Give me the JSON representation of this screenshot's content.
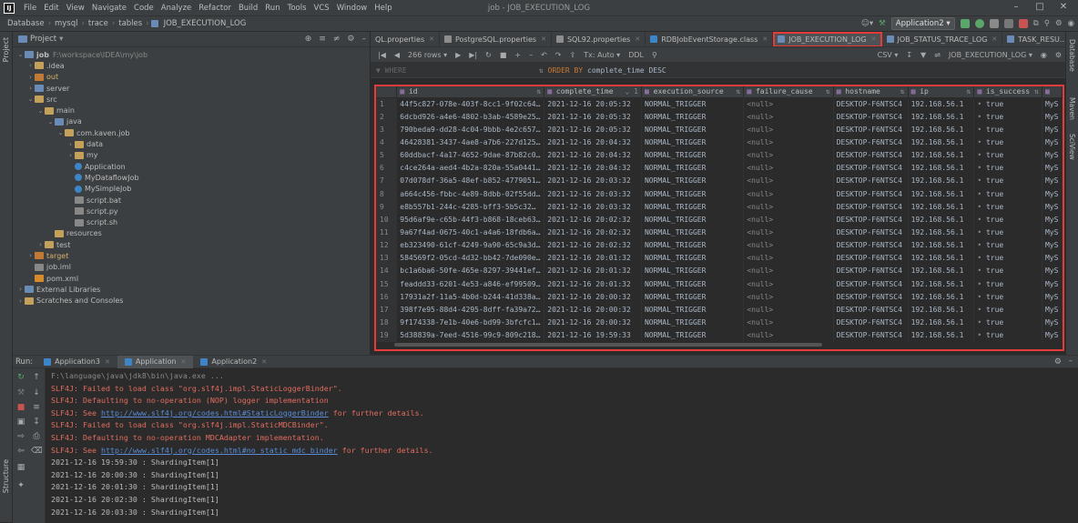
{
  "titlebar": {
    "menu": [
      "File",
      "Edit",
      "View",
      "Navigate",
      "Code",
      "Analyze",
      "Refactor",
      "Build",
      "Run",
      "Tools",
      "VCS",
      "Window",
      "Help"
    ],
    "title": "job - JOB_EXECUTION_LOG"
  },
  "breadcrumb": [
    "Database",
    "mysql",
    "trace",
    "tables",
    "JOB_EXECUTION_LOG"
  ],
  "toolbar": {
    "run_config": "Application2"
  },
  "project": {
    "header": "Project",
    "tree": [
      {
        "label": "job",
        "note": "F:\\workspace\\IDEA\\my\\job",
        "depth": 0,
        "open": true,
        "kind": "folder-blue"
      },
      {
        "label": ".idea",
        "depth": 1,
        "open": false,
        "kind": "folder"
      },
      {
        "label": "out",
        "depth": 1,
        "open": false,
        "kind": "folder-orange",
        "highlight": true
      },
      {
        "label": "server",
        "depth": 1,
        "open": false,
        "kind": "folder-blue"
      },
      {
        "label": "src",
        "depth": 1,
        "open": true,
        "kind": "folder"
      },
      {
        "label": "main",
        "depth": 2,
        "open": true,
        "kind": "folder"
      },
      {
        "label": "java",
        "depth": 3,
        "open": true,
        "kind": "folder-blue"
      },
      {
        "label": "com.kaven.job",
        "depth": 4,
        "open": true,
        "kind": "folder"
      },
      {
        "label": "data",
        "depth": 5,
        "open": false,
        "kind": "folder"
      },
      {
        "label": "my",
        "depth": 5,
        "open": false,
        "kind": "folder"
      },
      {
        "label": "Application",
        "depth": 5,
        "kind": "jcls"
      },
      {
        "label": "MyDataflowJob",
        "depth": 5,
        "kind": "jcls"
      },
      {
        "label": "MySimpleJob",
        "depth": 5,
        "kind": "jcls"
      },
      {
        "label": "script.bat",
        "depth": 5,
        "kind": "sfile"
      },
      {
        "label": "script.py",
        "depth": 5,
        "kind": "sfile"
      },
      {
        "label": "script.sh",
        "depth": 5,
        "kind": "sfile"
      },
      {
        "label": "resources",
        "depth": 3,
        "kind": "folder"
      },
      {
        "label": "test",
        "depth": 2,
        "open": false,
        "kind": "folder"
      },
      {
        "label": "target",
        "depth": 1,
        "open": false,
        "kind": "folder-orange",
        "highlight": true
      },
      {
        "label": "job.iml",
        "depth": 1,
        "kind": "sfile"
      },
      {
        "label": "pom.xml",
        "depth": 1,
        "kind": "xmlfile"
      },
      {
        "label": "External Libraries",
        "depth": 0,
        "open": false,
        "kind": "folder-blue"
      },
      {
        "label": "Scratches and Consoles",
        "depth": 0,
        "open": false,
        "kind": "folder"
      }
    ]
  },
  "editor": {
    "tabs": [
      {
        "label": "QL.properties",
        "color": "#8e8e8e"
      },
      {
        "label": "PostgreSQL.properties",
        "color": "#8e8e8e"
      },
      {
        "label": "SQL92.properties",
        "color": "#8e8e8e"
      },
      {
        "label": "RDBJobEventStorage.class",
        "color": "#3d85c6"
      },
      {
        "label": "JOB_EXECUTION_LOG",
        "color": "#6a8bb5",
        "active": true
      },
      {
        "label": "JOB_STATUS_TRACE_LOG",
        "color": "#6a8bb5"
      },
      {
        "label": "TASK_RESU...STATISTICS",
        "color": "#6a8bb5"
      }
    ],
    "db_toolbar": {
      "rows": "266 rows",
      "tx": "Tx: Auto",
      "ddl": "DDL",
      "export": "CSV",
      "table_selector": "JOB_EXECUTION_LOG"
    },
    "filter": {
      "where": "WHERE",
      "order_by_kw": "ORDER BY",
      "order_by_val": "complete_time DESC"
    },
    "columns": [
      "id",
      "complete_time",
      "execution_source",
      "failure_cause",
      "hostname",
      "ip",
      "is_success",
      ""
    ],
    "rows": [
      [
        "1",
        "44f5c827-078e-403f-8cc1-9f02c64…",
        "2021-12-16 20:05:32",
        "NORMAL_TRIGGER",
        "<null>",
        "DESKTOP-F6NTSC4",
        "192.168.56.1",
        "true",
        "MyS"
      ],
      [
        "2",
        "6dcbd926-a4e6-4802-b3ab-4589e25…",
        "2021-12-16 20:05:32",
        "NORMAL_TRIGGER",
        "<null>",
        "DESKTOP-F6NTSC4",
        "192.168.56.1",
        "true",
        "MyS"
      ],
      [
        "3",
        "790beda9-dd28-4c04-9bbb-4e2c657…",
        "2021-12-16 20:05:32",
        "NORMAL_TRIGGER",
        "<null>",
        "DESKTOP-F6NTSC4",
        "192.168.56.1",
        "true",
        "MyS"
      ],
      [
        "4",
        "46428381-3437-4ae8-a7b6-227d125…",
        "2021-12-16 20:04:32",
        "NORMAL_TRIGGER",
        "<null>",
        "DESKTOP-F6NTSC4",
        "192.168.56.1",
        "true",
        "MyS"
      ],
      [
        "5",
        "60ddbacf-4a17-4652-9dae-87b82c0…",
        "2021-12-16 20:04:32",
        "NORMAL_TRIGGER",
        "<null>",
        "DESKTOP-F6NTSC4",
        "192.168.56.1",
        "true",
        "MyS"
      ],
      [
        "6",
        "c4ce264a-aed4-4b2a-820a-55a0441…",
        "2021-12-16 20:04:32",
        "NORMAL_TRIGGER",
        "<null>",
        "DESKTOP-F6NTSC4",
        "192.168.56.1",
        "true",
        "MyS"
      ],
      [
        "7",
        "07d078df-36a5-48ef-b852-4779051…",
        "2021-12-16 20:03:32",
        "NORMAL_TRIGGER",
        "<null>",
        "DESKTOP-F6NTSC4",
        "192.168.56.1",
        "true",
        "MyS"
      ],
      [
        "8",
        "a664c456-fbbc-4e89-8dbb-02f55dd…",
        "2021-12-16 20:03:32",
        "NORMAL_TRIGGER",
        "<null>",
        "DESKTOP-F6NTSC4",
        "192.168.56.1",
        "true",
        "MyS"
      ],
      [
        "9",
        "e8b557b1-244c-4285-bff3-5b5c32…",
        "2021-12-16 20:03:32",
        "NORMAL_TRIGGER",
        "<null>",
        "DESKTOP-F6NTSC4",
        "192.168.56.1",
        "true",
        "MyS"
      ],
      [
        "10",
        "95d6af9e-c65b-44f3-b868-18ceb63…",
        "2021-12-16 20:02:32",
        "NORMAL_TRIGGER",
        "<null>",
        "DESKTOP-F6NTSC4",
        "192.168.56.1",
        "true",
        "MyS"
      ],
      [
        "11",
        "9a67f4ad-0675-40c1-a4a6-18fdb6a…",
        "2021-12-16 20:02:32",
        "NORMAL_TRIGGER",
        "<null>",
        "DESKTOP-F6NTSC4",
        "192.168.56.1",
        "true",
        "MyS"
      ],
      [
        "12",
        "eb323490-61cf-4249-9a90-65c9a3d…",
        "2021-12-16 20:02:32",
        "NORMAL_TRIGGER",
        "<null>",
        "DESKTOP-F6NTSC4",
        "192.168.56.1",
        "true",
        "MyS"
      ],
      [
        "13",
        "584569f2-05cd-4d32-bb42-7de090e…",
        "2021-12-16 20:01:32",
        "NORMAL_TRIGGER",
        "<null>",
        "DESKTOP-F6NTSC4",
        "192.168.56.1",
        "true",
        "MyS"
      ],
      [
        "14",
        "bc1a6ba6-50fe-465e-8297-39441ef…",
        "2021-12-16 20:01:32",
        "NORMAL_TRIGGER",
        "<null>",
        "DESKTOP-F6NTSC4",
        "192.168.56.1",
        "true",
        "MyS"
      ],
      [
        "15",
        "feaddd33-6201-4e53-a846-ef99509…",
        "2021-12-16 20:01:32",
        "NORMAL_TRIGGER",
        "<null>",
        "DESKTOP-F6NTSC4",
        "192.168.56.1",
        "true",
        "MyS"
      ],
      [
        "16",
        "17931a2f-11a5-4b0d-b244-41d338a…",
        "2021-12-16 20:00:32",
        "NORMAL_TRIGGER",
        "<null>",
        "DESKTOP-F6NTSC4",
        "192.168.56.1",
        "true",
        "MyS"
      ],
      [
        "17",
        "398f7e95-88d4-4295-8dff-fa39a72…",
        "2021-12-16 20:00:32",
        "NORMAL_TRIGGER",
        "<null>",
        "DESKTOP-F6NTSC4",
        "192.168.56.1",
        "true",
        "MyS"
      ],
      [
        "18",
        "9f174338-7e1b-40e6-bd99-3bfcfc1…",
        "2021-12-16 20:00:32",
        "NORMAL_TRIGGER",
        "<null>",
        "DESKTOP-F6NTSC4",
        "192.168.56.1",
        "true",
        "MyS"
      ],
      [
        "19",
        "5d38839a-7eed-4516-99c9-809c218…",
        "2021-12-16 19:59:33",
        "NORMAL_TRIGGER",
        "<null>",
        "DESKTOP-F6NTSC4",
        "192.168.56.1",
        "true",
        "MyS"
      ]
    ]
  },
  "run": {
    "label": "Run:",
    "tabs": [
      {
        "label": "Application3"
      },
      {
        "label": "Application",
        "active": true
      },
      {
        "label": "Application2"
      }
    ],
    "console": [
      {
        "type": "cmd",
        "text": "F:\\language\\java\\jdk8\\bin\\java.exe ..."
      },
      {
        "type": "err",
        "text": "SLF4J: Failed to load class \"org.slf4j.impl.StaticLoggerBinder\"."
      },
      {
        "type": "err",
        "text": "SLF4J: Defaulting to no-operation (NOP) logger implementation"
      },
      {
        "type": "errlink",
        "pre": "SLF4J: See ",
        "link": "http://www.slf4j.org/codes.html#StaticLoggerBinder",
        "post": " for further details."
      },
      {
        "type": "err",
        "text": "SLF4J: Failed to load class \"org.slf4j.impl.StaticMDCBinder\"."
      },
      {
        "type": "err",
        "text": "SLF4J: Defaulting to no-operation MDCAdapter implementation."
      },
      {
        "type": "errlink",
        "pre": "SLF4J: See ",
        "link": "http://www.slf4j.org/codes.html#no_static_mdc_binder",
        "post": " for further details."
      },
      {
        "type": "out",
        "text": "2021-12-16 19:59:30 : ShardingItem[1]"
      },
      {
        "type": "out",
        "text": "2021-12-16 20:00:30 : ShardingItem[1]"
      },
      {
        "type": "out",
        "text": "2021-12-16 20:01:30 : ShardingItem[1]"
      },
      {
        "type": "out",
        "text": "2021-12-16 20:02:30 : ShardingItem[1]"
      },
      {
        "type": "out",
        "text": "2021-12-16 20:03:30 : ShardingItem[1]"
      }
    ]
  },
  "sidebar": {
    "left": [
      "Project",
      "Structure"
    ],
    "right": [
      "Database",
      "Maven",
      "SciView"
    ]
  }
}
